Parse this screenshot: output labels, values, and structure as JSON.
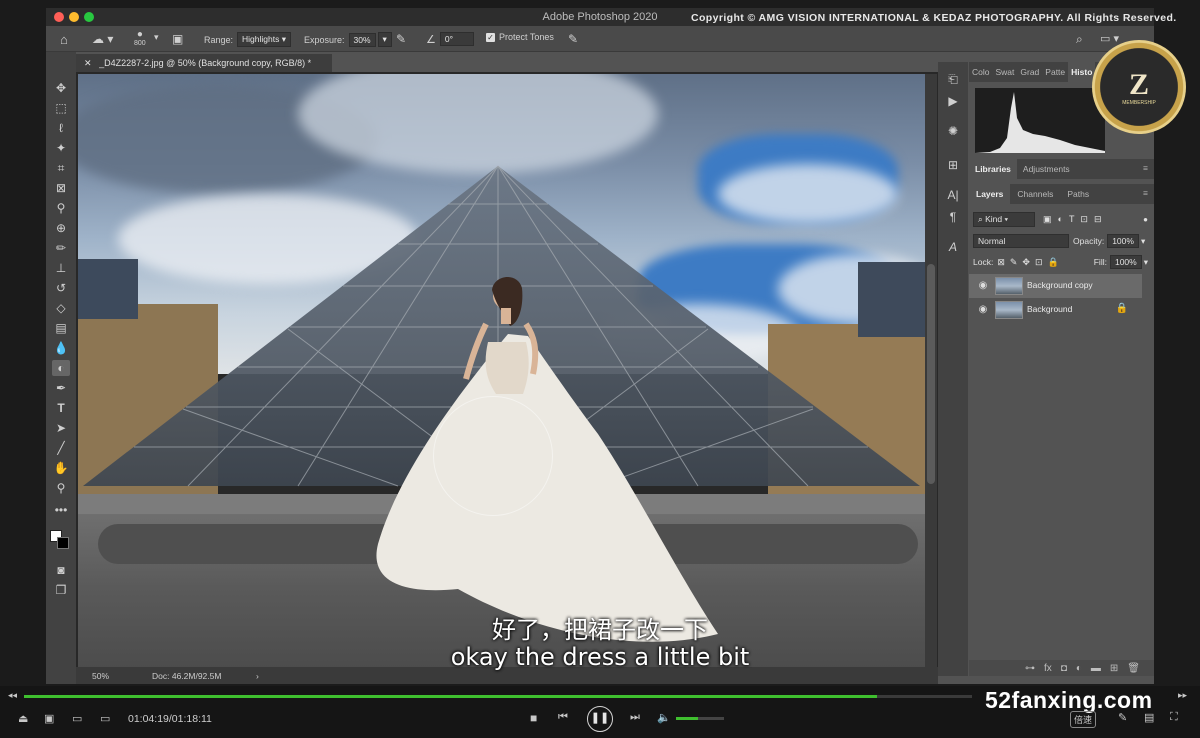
{
  "window": {
    "title": "Adobe Photoshop 2020",
    "traffic_colors": [
      "#ff5f57",
      "#febc2e",
      "#28c840"
    ],
    "copyright": "Copyright © AMG VISION INTERNATIONAL & KEDAZ PHOTOGRAPHY. All Rights Reserved."
  },
  "options_bar": {
    "brush_size": "800",
    "range_label": "Range:",
    "range_value": "Highlights",
    "exposure_label": "Exposure:",
    "exposure_value": "30%",
    "angle_value": "0°",
    "protect_tones_label": "Protect Tones",
    "protect_tones_checked": true
  },
  "document": {
    "tab_title": "_D4Z2287-2.jpg @ 50% (Background copy, RGB/8) *",
    "zoom": "50%",
    "doc_size": "Doc: 46.2M/92.5M"
  },
  "tools": [
    "move-tool",
    "marquee-tool",
    "lasso-tool",
    "magic-wand-tool",
    "crop-tool",
    "frame-tool",
    "eyedropper-tool",
    "healing-brush-tool",
    "brush-tool",
    "clone-stamp-tool",
    "history-brush-tool",
    "eraser-tool",
    "gradient-tool",
    "blur-tool",
    "dodge-tool",
    "pen-tool",
    "type-tool",
    "path-selection-tool",
    "line-tool",
    "hand-tool",
    "zoom-tool",
    "more-tools"
  ],
  "panels": {
    "top_tabs": [
      "Colo",
      "Swat",
      "Grad",
      "Patte",
      "Histo"
    ],
    "mid_tabs": [
      "Libraries",
      "Adjustments"
    ],
    "layer_tabs": [
      "Layers",
      "Channels",
      "Paths"
    ],
    "kind_filter": "Kind",
    "blend_mode": "Normal",
    "opacity_label": "Opacity:",
    "opacity_value": "100%",
    "lock_label": "Lock:",
    "fill_label": "Fill:",
    "fill_value": "100%",
    "layers": [
      {
        "name": "Background copy",
        "active": true,
        "locked": false
      },
      {
        "name": "Background",
        "active": false,
        "locked": true
      }
    ]
  },
  "badge": {
    "letter": "Z",
    "text": "MEMBERSHIP"
  },
  "subtitles": {
    "chinese": "好了，把裙子改一下",
    "english": "okay the dress a little bit"
  },
  "player": {
    "time": "01:04:19/01:18:11",
    "progress": 0.9,
    "volume": 0.45,
    "speed_label": "倍速",
    "watermark": "52fanxing.com"
  }
}
